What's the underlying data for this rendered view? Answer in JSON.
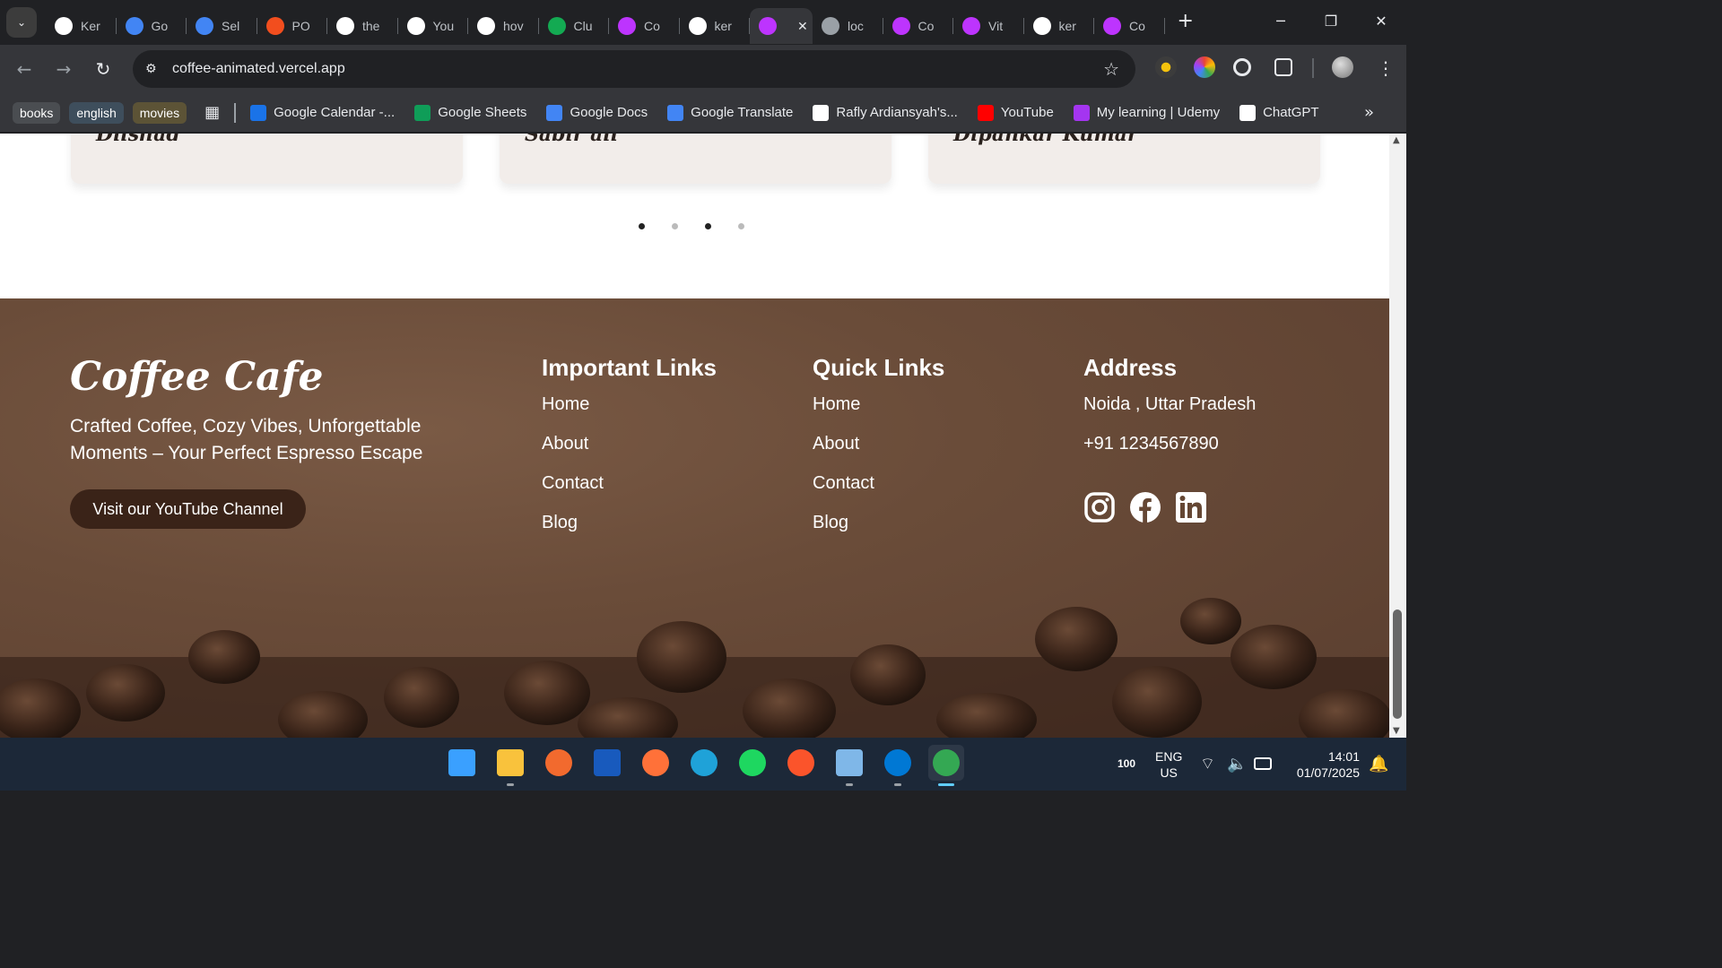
{
  "browser": {
    "tabs": [
      {
        "label": "Ker",
        "icon": "kr-avatar-icon",
        "color": "#ffffff"
      },
      {
        "label": "Go",
        "icon": "google-calendar-icon",
        "color": "#4285f4"
      },
      {
        "label": "Sel",
        "icon": "google-docs-icon",
        "color": "#4285f4"
      },
      {
        "label": "PO",
        "icon": "figma-icon",
        "color": "#f24e1e"
      },
      {
        "label": "the",
        "icon": "b-logo-icon",
        "color": "#ffffff"
      },
      {
        "label": "You",
        "icon": "github-icon",
        "color": "#ffffff"
      },
      {
        "label": "hov",
        "icon": "google-icon",
        "color": "#ffffff"
      },
      {
        "label": "Clu",
        "icon": "mongodb-icon",
        "color": "#13aa52"
      },
      {
        "label": "Co",
        "icon": "vite-icon",
        "color": "#bd34fe"
      },
      {
        "label": "ker",
        "icon": "github-icon",
        "color": "#ffffff"
      },
      {
        "label": "",
        "icon": "vite-icon",
        "color": "#bd34fe",
        "active": true
      },
      {
        "label": "loc",
        "icon": "globe-icon",
        "color": "#9aa0a6"
      },
      {
        "label": "Co",
        "icon": "vite-icon",
        "color": "#bd34fe"
      },
      {
        "label": "Vit",
        "icon": "vite-icon",
        "color": "#bd34fe"
      },
      {
        "label": "ker",
        "icon": "github-icon",
        "color": "#ffffff"
      },
      {
        "label": "Co",
        "icon": "vite-icon",
        "color": "#bd34fe"
      }
    ],
    "url": "coffee-animated.vercel.app",
    "bookmark_chips": [
      {
        "label": "books",
        "color": "#4a4d51"
      },
      {
        "label": "english",
        "color": "#3e4e5c"
      },
      {
        "label": "movies",
        "color": "#5c5336"
      }
    ],
    "bookmarks": [
      {
        "label": "Google Calendar -...",
        "icon": "google-calendar-icon",
        "color": "#1a73e8"
      },
      {
        "label": "Google Sheets",
        "icon": "google-sheets-icon",
        "color": "#0f9d58"
      },
      {
        "label": "Google Docs",
        "icon": "google-docs-icon",
        "color": "#4285f4"
      },
      {
        "label": "Google Translate",
        "icon": "google-translate-icon",
        "color": "#4285f4"
      },
      {
        "label": "Rafly Ardiansyah's...",
        "icon": "notion-icon",
        "color": "#ffffff"
      },
      {
        "label": "YouTube",
        "icon": "youtube-icon",
        "color": "#ff0000"
      },
      {
        "label": "My learning | Udemy",
        "icon": "udemy-icon",
        "color": "#a435f0"
      },
      {
        "label": "ChatGPT",
        "icon": "chatgpt-icon",
        "color": "#ffffff"
      }
    ]
  },
  "page": {
    "testimonials": [
      "Dilshad",
      "Sabir ali",
      "Dipankar Kumar"
    ],
    "carousel_dots": [
      true,
      false,
      true,
      false
    ],
    "footer": {
      "brand": "Coffee Cafe",
      "tagline": "Crafted Coffee, Cozy Vibes, Unforgettable Moments – Your Perfect Espresso Escape",
      "youtube_button": "Visit our YouTube Channel",
      "important_links": {
        "title": "Important Links",
        "items": [
          "Home",
          "About",
          "Contact",
          "Blog"
        ]
      },
      "quick_links": {
        "title": "Quick Links",
        "items": [
          "Home",
          "About",
          "Contact",
          "Blog"
        ]
      },
      "address": {
        "title": "Address",
        "location": "Noida , Uttar Pradesh",
        "phone": "+91 1234567890"
      },
      "social": [
        "instagram-icon",
        "facebook-icon",
        "linkedin-icon"
      ]
    }
  },
  "taskbar": {
    "apps": [
      {
        "name": "windows-start-icon",
        "open": false
      },
      {
        "name": "file-explorer-icon",
        "open": true
      },
      {
        "name": "pen-app-icon",
        "open": false
      },
      {
        "name": "word-icon",
        "open": false
      },
      {
        "name": "firefox-icon",
        "open": false
      },
      {
        "name": "edge-icon",
        "open": false
      },
      {
        "name": "spotify-icon",
        "open": false
      },
      {
        "name": "brave-icon",
        "open": false
      },
      {
        "name": "notepad-icon",
        "open": true
      },
      {
        "name": "vscode-icon",
        "open": true
      },
      {
        "name": "chrome-icon",
        "open": true,
        "active": true
      }
    ],
    "tray": {
      "battery": "100",
      "lang": "ENG",
      "region": "US",
      "time": "14:01",
      "date": "01/07/2025"
    }
  }
}
